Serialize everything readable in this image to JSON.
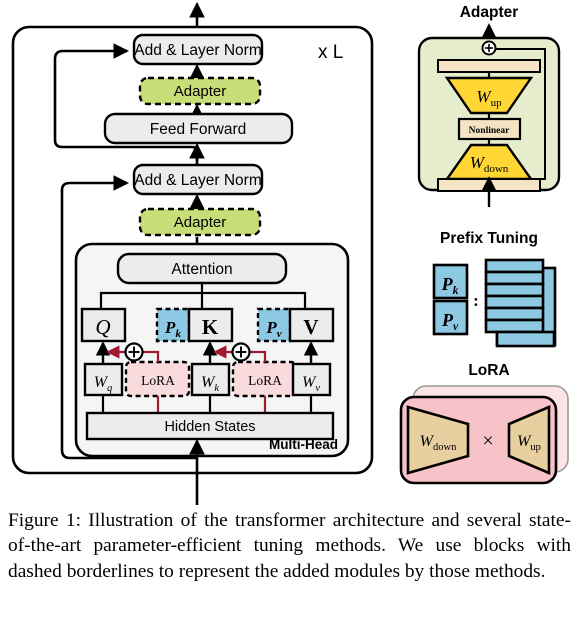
{
  "figure": {
    "caption": "Figure 1: Illustration of the transformer architecture and several state-of-the-art parameter-efficient tuning methods.  We use blocks with dashed borderlines to represent the added modules by those methods.",
    "caption_label": "Figure 1:"
  },
  "transformer": {
    "repeat_label": "x L",
    "add_norm_top": "Add & Layer Norm",
    "adapter_top": "Adapter",
    "feed_forward": "Feed Forward",
    "add_norm_bottom": "Add & Layer Norm",
    "adapter_bottom": "Adapter",
    "attention": "Attention",
    "hidden_states": "Hidden States",
    "multi_head": "Multi-Head",
    "q": "Q",
    "k": "K",
    "v": "V",
    "p_k": "P",
    "p_k_sub": "k",
    "p_v": "P",
    "p_v_sub": "v",
    "w_q": "W",
    "w_q_sub": "q",
    "w_k": "W",
    "w_k_sub": "k",
    "w_v": "W",
    "w_v_sub": "v",
    "lora_q": "LoRA",
    "lora_k": "LoRA",
    "plus_1": "+",
    "plus_2": "+"
  },
  "adapter_panel": {
    "title": "Adapter",
    "w_up": "W",
    "w_up_sub": "up",
    "w_down": "W",
    "w_down_sub": "down",
    "nonlinear": "Nonlinear",
    "sum": "+"
  },
  "prefix_panel": {
    "title": "Prefix Tuning",
    "p_k": "P",
    "p_k_sub": "k",
    "p_v": "P",
    "p_v_sub": "v",
    "separator": ":",
    "stack_rows": 6
  },
  "lora_panel": {
    "title": "LoRA",
    "w_down": "W",
    "w_down_sub": "down",
    "w_up": "W",
    "w_up_sub": "up",
    "times": "×"
  },
  "colors": {
    "adapter_green": "#c8dc77",
    "block_gray": "#ececec",
    "inner_panel": "#f5f5f5",
    "prefix_blue": "#8ec9e3",
    "lora_pink": "#fadbdd",
    "lora_panel_pink": "#f7c3c9",
    "lora_tan": "#e8cfa0",
    "adapter_panel_bg": "#e6edcd",
    "yellow": "#ffd633",
    "cream": "#f4e4c3",
    "dark_red": "#9e1b32",
    "stroke": "#000000"
  }
}
